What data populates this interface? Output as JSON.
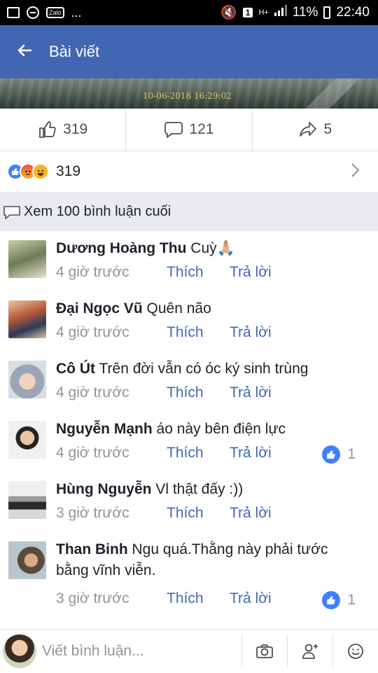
{
  "status": {
    "network": "H+",
    "battery_percent": "11%",
    "time": "22:40",
    "sim": "1",
    "zalo": "Zalo",
    "more": "..."
  },
  "appbar": {
    "title": "Bài viết"
  },
  "media": {
    "timestamp": "10-06-2018  16:29:02"
  },
  "actions": {
    "likes": "319",
    "comments": "121",
    "shares": "5"
  },
  "reactions": {
    "count": "319"
  },
  "view_previous": "Xem 100 bình luận cuối",
  "comments": [
    {
      "name": "Dương Hoàng Thu",
      "text": "Cuỳ🙏🏼",
      "time": "4 giờ trước",
      "like": "Thích",
      "reply": "Trả lời",
      "likes": ""
    },
    {
      "name": "Đại Ngọc Vũ",
      "text": "Quên não",
      "time": "4 giờ trước",
      "like": "Thích",
      "reply": "Trả lời",
      "likes": ""
    },
    {
      "name": "Cô Út",
      "text": "Trên đời vẫn có óc ký sinh trùng",
      "time": "4 giờ trước",
      "like": "Thích",
      "reply": "Trả lời",
      "likes": ""
    },
    {
      "name": "Nguyễn Mạnh",
      "text": "áo này bên điện lực",
      "time": "4 giờ trước",
      "like": "Thích",
      "reply": "Trả lời",
      "likes": "1"
    },
    {
      "name": "Hùng Nguyễn",
      "text": "Vl thật đấy :))",
      "time": "3 giờ trước",
      "like": "Thích",
      "reply": "Trả lời",
      "likes": ""
    },
    {
      "name": "Than Binh",
      "text": "Ngu quá.Thằng này phải tước bằng vĩnh viễn.",
      "time": "3 giờ trước",
      "like": "Thích",
      "reply": "Trả lời",
      "likes": "1"
    }
  ],
  "composer": {
    "placeholder": "Viết bình luận..."
  },
  "colors": {
    "brand": "#4267b2",
    "like_blue": "#4080ff",
    "muted": "#90949c",
    "text": "#1d2129"
  },
  "icons": [
    "picture-icon",
    "dnd-icon",
    "zalo-icon",
    "mute-icon",
    "sim-icon",
    "signal-icon",
    "battery-icon",
    "back-arrow-icon",
    "like-icon",
    "comment-icon",
    "share-icon",
    "chevron-right-icon",
    "camera-icon",
    "add-friend-icon",
    "emoji-icon"
  ]
}
